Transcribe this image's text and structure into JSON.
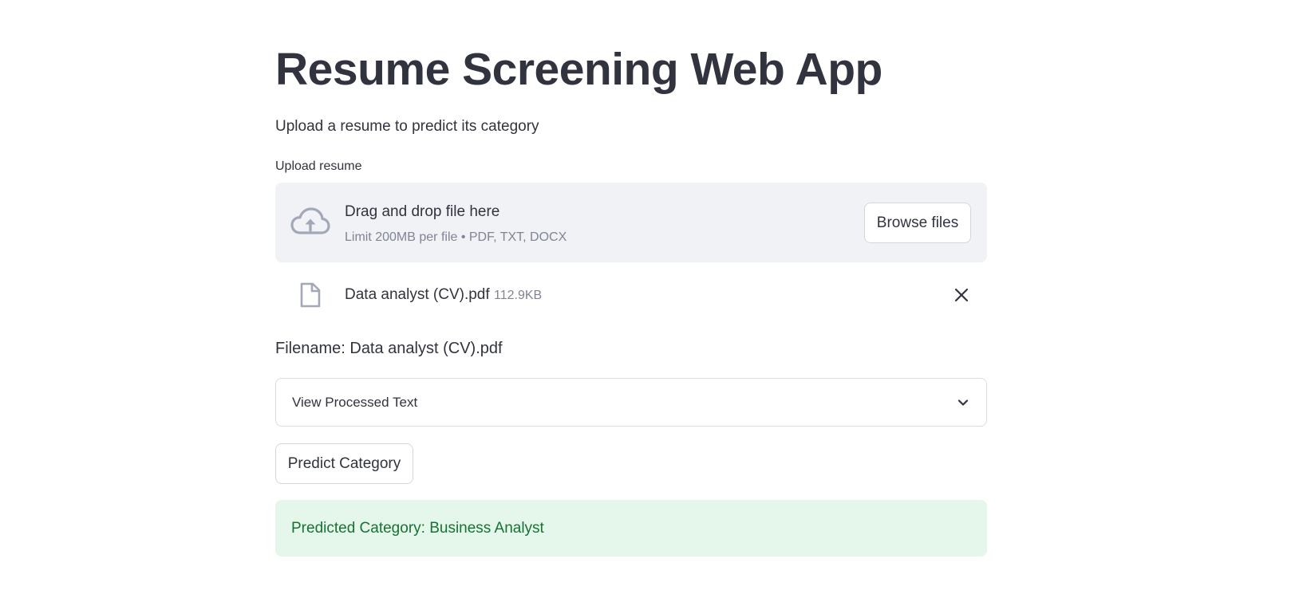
{
  "app": {
    "title": "Resume Screening Web App",
    "subtitle": "Upload a resume to predict its category"
  },
  "uploader": {
    "label": "Upload resume",
    "drop_text": "Drag and drop file here",
    "limit_text": "Limit 200MB per file • PDF, TXT, DOCX",
    "browse_label": "Browse files",
    "file": {
      "name": "Data analyst (CV).pdf",
      "size": "112.9KB"
    }
  },
  "filename_text": "Filename: Data analyst (CV).pdf",
  "expander": {
    "label": "View Processed Text"
  },
  "predict_button": "Predict Category",
  "result": {
    "text": "Predicted Category: Business Analyst"
  },
  "colors": {
    "text": "#31333f",
    "muted": "#808495",
    "dropzone_bg": "#f0f2f6",
    "success_bg": "#e4f7ea",
    "success_text": "#177233"
  },
  "icons": {
    "upload": "cloud-upload-icon",
    "file": "file-icon",
    "remove": "close-icon",
    "expander": "chevron-down-icon"
  }
}
